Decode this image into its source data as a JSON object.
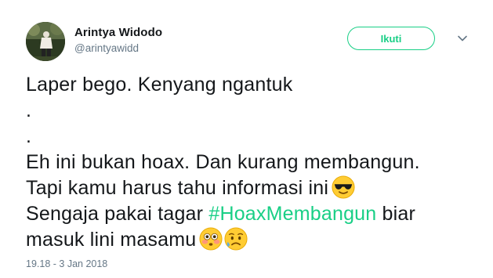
{
  "author": {
    "display_name": "Arintya Widodo",
    "handle": "@arintyawidd"
  },
  "actions": {
    "follow_label": "Ikuti",
    "menu_icon": "chevron-down-icon"
  },
  "tweet": {
    "line1": "Laper bego. Kenyang ngantuk",
    "line2": ".",
    "line3": ".",
    "line4": "Eh ini bukan hoax. Dan kurang membangun.",
    "line5": "Tapi kamu harus tahu informasi ini",
    "line6_prefix": "Sengaja pakai tagar ",
    "hashtag": "#HoaxMembangun",
    "line6_suffix": " biar",
    "line7": "masuk lini masamu",
    "emojis": [
      "sunglasses-emoji-icon",
      "flushed-emoji-icon",
      "sad-sweat-emoji-icon"
    ]
  },
  "meta": {
    "timestamp": "19.18 - 3 Jan 2018"
  },
  "colors": {
    "accent": "#19cf86",
    "text": "#14171a",
    "secondary": "#657786"
  }
}
